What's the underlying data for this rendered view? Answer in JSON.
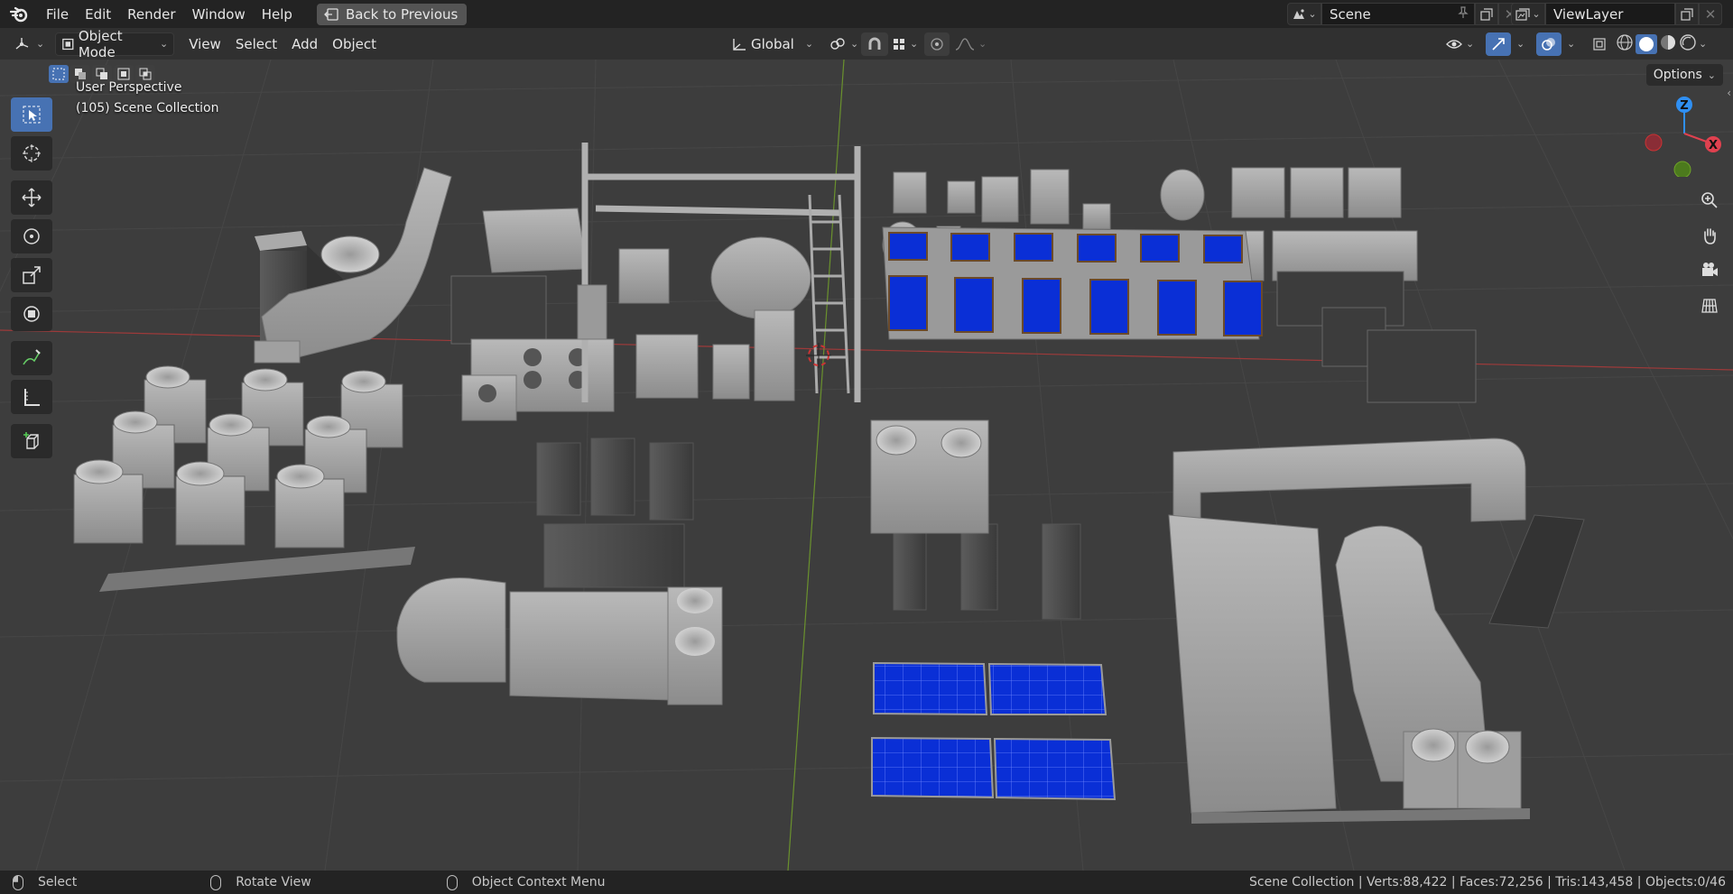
{
  "menu": {
    "items": [
      "File",
      "Edit",
      "Render",
      "Window",
      "Help"
    ],
    "back_button": "Back to Previous"
  },
  "scene": {
    "name": "Scene"
  },
  "view_layer": {
    "name": "ViewLayer"
  },
  "header": {
    "mode": "Object Mode",
    "menus": [
      "View",
      "Select",
      "Add",
      "Object"
    ],
    "transform_orientation": "Global"
  },
  "viewport": {
    "perspective_label": "User Perspective",
    "collection_label": "(105) Scene Collection",
    "options_label": "Options",
    "gizmo_axes": {
      "z": "Z",
      "x": "X"
    }
  },
  "colors": {
    "accent": "#4772b3",
    "axis_x": "#e0414f",
    "axis_y": "#6fa12a",
    "axis_z": "#2f8ff2",
    "panel_blue": "#0a2fd6"
  },
  "statusbar": {
    "left": "Select",
    "middle": "Rotate View",
    "right": "Object Context Menu",
    "stats": "Scene Collection | Verts:88,422 | Faces:72,256 | Tris:143,458 | Objects:0/46"
  }
}
